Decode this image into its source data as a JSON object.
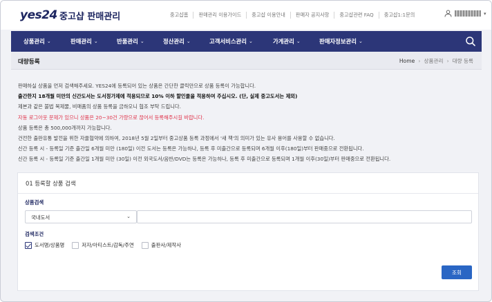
{
  "header": {
    "logo_text": "yes24",
    "brand_title": "중고샵 판매관리",
    "top_links": [
      "중고샵홈",
      "판매관리 이용가이드",
      "중고샵 이용안내",
      "판매자 공지사항",
      "중고샵관련 FAQ",
      "중고샵1:1문의"
    ]
  },
  "nav": {
    "items": [
      "상품관리",
      "판매관리",
      "반품관리",
      "정산관리",
      "고객서비스관리",
      "가게관리",
      "판매자정보관리"
    ]
  },
  "page": {
    "title": "대량등록",
    "breadcrumb": [
      "Home",
      "상품관리",
      "대량 등록"
    ]
  },
  "notice": {
    "line1": "판매하실 상품을 먼저 검색해주세요. YES24에 등록되어 있는 상품은 간단한 클릭만으로 상품 등록이 가능합니다.",
    "line2": "출간한지 18개월 미만의 신간도서는 도서정가제에 적용되므로 10% 이하 할인율을 적용하여 주십시오. (단, 실제 중고도서는 제외)",
    "line3": "제본과 같은 불법 복제물, 비매품의 상품 등록을 금하오니 협조 부탁 드립니다.",
    "line4": "자동 로그아웃 문제가 있으니 상품은 20~30건 가량으로 끊어서 등록해주시길 바랍니다.",
    "line5": "상품 등록은 총 500,000개까지 가능합니다.",
    "line6": "건전한 출판유통 발전을 위한 자율협약에 의하여, 2018년 5월 2일부터 중고상품 등록 과정에서 '새 책'의 의미가 있는 유사 용어를 사용할 수 없습니다.",
    "line7": "신간 등록 시 - 등록일 기준 출간일 6개월 미만 (180일) 이전 도서는 등록은 가능하나, 등록 후 미출간으로 등록되며 6개월 이후(180일)부터 판매중으로 전환됩니다.",
    "line8": "신간 등록 시 - 등록일 기준 출간일 1개월 미만 (30일) 이전 외국도서/음반/DVD는 등록은 가능하나, 등록 후 미출간으로 등록되며 1개월 이후(30일)부터 판매중으로 전환됩니다."
  },
  "search_panel": {
    "title": "01 등록할 상품 검색",
    "product_search_label": "상품검색",
    "category_selected": "국내도서",
    "query_value": "",
    "conditions_label": "검색조건",
    "conditions": [
      {
        "label": "도서명/상품명",
        "checked": true
      },
      {
        "label": "저자/아티스트/감독/주연",
        "checked": false
      },
      {
        "label": "출판사/제작사",
        "checked": false
      }
    ],
    "submit_label": "조회"
  },
  "colors": {
    "nav_bg": "#2c3678",
    "brand": "#1d2660",
    "accent_button": "#2a66c4",
    "warning_text": "#e0334a"
  }
}
